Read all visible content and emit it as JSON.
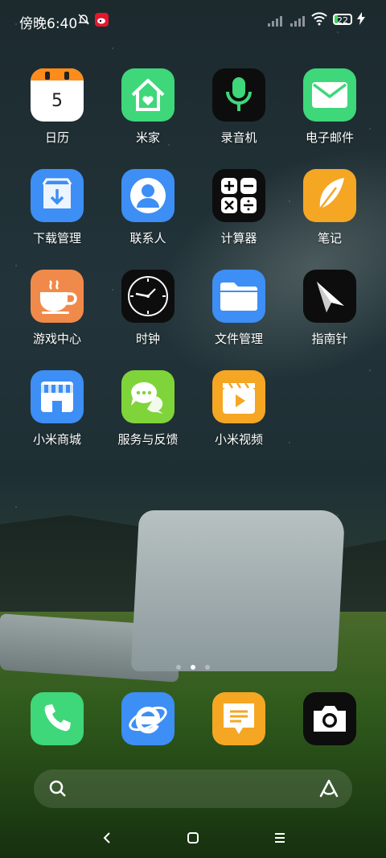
{
  "status_bar": {
    "time": "傍晚6:40",
    "battery_level": "22",
    "icons": [
      "alarm-off-icon",
      "weibo-icon",
      "signal-icon",
      "signal-icon",
      "wifi-icon",
      "battery-icon",
      "charging-icon"
    ]
  },
  "apps": [
    {
      "label": "日历",
      "icon": "calendar-icon",
      "day": "5"
    },
    {
      "label": "米家",
      "icon": "mijia-home-icon"
    },
    {
      "label": "录音机",
      "icon": "microphone-icon"
    },
    {
      "label": "电子邮件",
      "icon": "mail-icon"
    },
    {
      "label": "下载管理",
      "icon": "download-icon"
    },
    {
      "label": "联系人",
      "icon": "contacts-icon"
    },
    {
      "label": "计算器",
      "icon": "calculator-icon"
    },
    {
      "label": "笔记",
      "icon": "feather-icon"
    },
    {
      "label": "游戏中心",
      "icon": "coffee-cup-icon"
    },
    {
      "label": "时钟",
      "icon": "clock-icon"
    },
    {
      "label": "文件管理",
      "icon": "folder-icon"
    },
    {
      "label": "指南针",
      "icon": "compass-icon"
    },
    {
      "label": "小米商城",
      "icon": "store-icon"
    },
    {
      "label": "服务与反馈",
      "icon": "chat-bubbles-icon"
    },
    {
      "label": "小米视频",
      "icon": "video-icon"
    }
  ],
  "dock": [
    {
      "icon": "phone-icon"
    },
    {
      "icon": "browser-icon"
    },
    {
      "icon": "message-icon"
    },
    {
      "icon": "camera-icon"
    }
  ],
  "page_indicator": {
    "pages": 3,
    "active": 1
  },
  "search_bar": {
    "left_icon": "search-icon",
    "right_icon": "assistant-icon"
  },
  "nav_bar": {
    "back": "back-icon",
    "home": "home-icon",
    "menu": "menu-icon"
  },
  "colors": {
    "green": "#3ed77a",
    "blue": "#3d8ef5",
    "black": "#0d0d0d",
    "orange": "#f59d2e",
    "lime": "#7fd43a",
    "coral": "#f08a4a"
  }
}
